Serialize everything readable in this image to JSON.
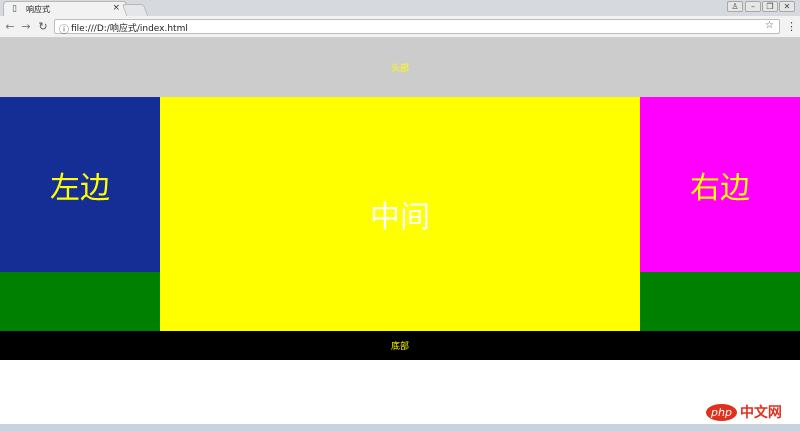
{
  "browser": {
    "tab_title": "响应式",
    "tab_close": "×",
    "url": "file:///D:/响应式/index.html",
    "window_controls": [
      "user-icon",
      "minimize-icon",
      "restore-icon",
      "close-icon"
    ]
  },
  "page": {
    "header": "头部",
    "left": "左边",
    "center": "中间",
    "right": "右边",
    "footer": "底部"
  },
  "colors": {
    "header_bg": "#cccccc",
    "left_bg": "#142e96",
    "center_bg": "#ffff00",
    "right_bg": "#ff00ff",
    "side_bottom_bg": "#008000",
    "footer_bg": "#000000",
    "accent_text": "#ffff00"
  },
  "watermark": {
    "badge": "php",
    "text": "中文网"
  }
}
